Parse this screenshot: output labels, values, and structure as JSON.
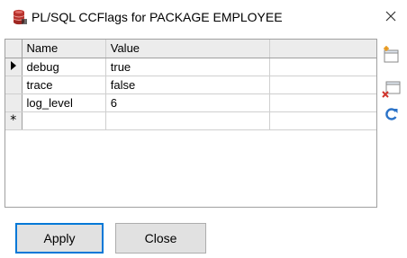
{
  "window": {
    "title": "PL/SQL CCFlags for PACKAGE EMPLOYEE"
  },
  "grid": {
    "columns": [
      "Name",
      "Value"
    ],
    "rows": [
      {
        "name": "debug",
        "value": "true",
        "current": true
      },
      {
        "name": "trace",
        "value": "false",
        "current": false
      },
      {
        "name": "log_level",
        "value": "6",
        "current": false
      }
    ],
    "new_row_marker": "*"
  },
  "side_tools": [
    {
      "icon": "add-row-icon"
    },
    {
      "icon": "delete-row-icon"
    },
    {
      "icon": "refresh-icon"
    }
  ],
  "buttons": {
    "apply": "Apply",
    "close": "Close"
  },
  "colors": {
    "header_bg": "#ececec",
    "button_bg": "#e1e1e1",
    "default_button_border": "#0078d7",
    "db_icon": "#b8322d",
    "refresh_icon": "#2b73c8"
  }
}
